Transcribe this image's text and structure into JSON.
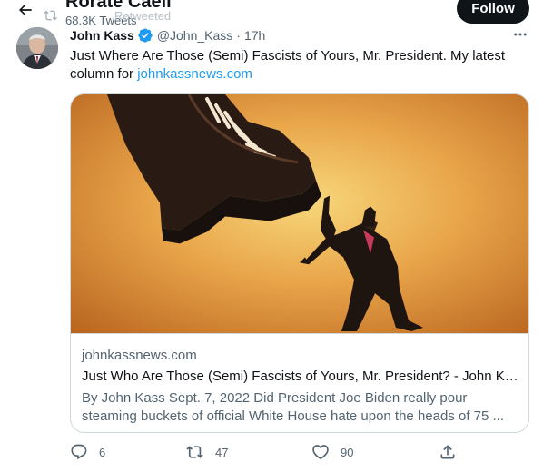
{
  "header": {
    "title": "Rorate Caeli",
    "tweet_count": "68.3K Tweets",
    "follow_label": "Follow",
    "retweeted_label": "Retweeted"
  },
  "tweet": {
    "author_name": "John Kass",
    "handle": "@John_Kass",
    "separator": "·",
    "time": "17h",
    "text_before_link": "Just Where Are Those (Semi) Fascists of Yours, Mr. President. My latest column for ",
    "link_text": "johnkassnews.com",
    "card": {
      "domain": "johnkassnews.com",
      "title": "Just Who Are Those (Semi) Fascists of Yours, Mr. President? - John Kass",
      "description": "By John Kass Sept. 7, 2022 Did President Joe Biden really pour steaming buckets of official White House hate upon the heads of 75 ..."
    },
    "actions": {
      "replies": "6",
      "retweets": "47",
      "likes": "90"
    }
  },
  "colors": {
    "accent": "#1d9bf0",
    "text_secondary": "#536471",
    "border": "#cfd9de",
    "verified": "#1d9bf0"
  },
  "icons": [
    "back-arrow-icon",
    "retweet-icon",
    "verified-icon",
    "more-icon",
    "reply-icon",
    "like-icon",
    "share-icon"
  ]
}
